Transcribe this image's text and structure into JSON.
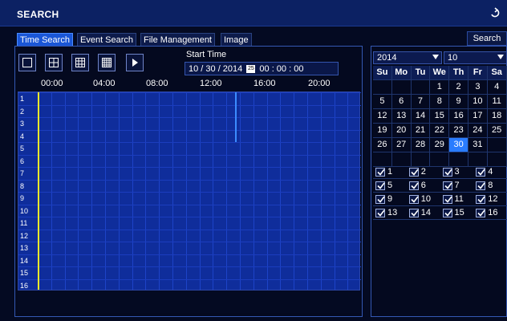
{
  "window": {
    "title": "SEARCH",
    "back_icon": "back-arrow-icon"
  },
  "tabs": [
    {
      "label": "Time Search",
      "active": true
    },
    {
      "label": "Event Search"
    },
    {
      "label": "File Management"
    },
    {
      "label": "Image"
    }
  ],
  "search_button": "Search",
  "toolbar": {
    "icons": [
      "single-view-icon",
      "quad-view-icon",
      "nine-view-icon",
      "sixteen-view-icon",
      "play-icon"
    ]
  },
  "start_time": {
    "label": "Start Time",
    "date": "10 / 30 / 2014",
    "calendar_glyph": "25",
    "time": "00 : 00 : 00"
  },
  "timeline": {
    "ticks": [
      "00:00",
      "04:00",
      "08:00",
      "12:00",
      "16:00",
      "20:00"
    ]
  },
  "channels": [
    "1",
    "2",
    "3",
    "4",
    "5",
    "6",
    "7",
    "8",
    "9",
    "10",
    "11",
    "12",
    "13",
    "14",
    "15",
    "16"
  ],
  "calendar": {
    "year": "2014",
    "month": "10",
    "weekdays": [
      "Su",
      "Mo",
      "Tu",
      "We",
      "Th",
      "Fr",
      "Sa"
    ],
    "weeks": [
      [
        "",
        "",
        "",
        "1",
        "2",
        "3",
        "4"
      ],
      [
        "5",
        "6",
        "7",
        "8",
        "9",
        "10",
        "11"
      ],
      [
        "12",
        "13",
        "14",
        "15",
        "16",
        "17",
        "18"
      ],
      [
        "19",
        "20",
        "21",
        "22",
        "23",
        "24",
        "25"
      ],
      [
        "26",
        "27",
        "28",
        "29",
        "30",
        "31",
        ""
      ]
    ],
    "selected_day": "30"
  },
  "channel_checks": [
    [
      "1",
      "2",
      "3",
      "4"
    ],
    [
      "5",
      "6",
      "7",
      "8"
    ],
    [
      "9",
      "10",
      "11",
      "12"
    ],
    [
      "13",
      "14",
      "15",
      "16"
    ]
  ],
  "colors": {
    "accent": "#2a7cff",
    "timeline_fill": "#0f2d9b",
    "cursor": "#f7ea2a",
    "record": "#3c8cff"
  }
}
